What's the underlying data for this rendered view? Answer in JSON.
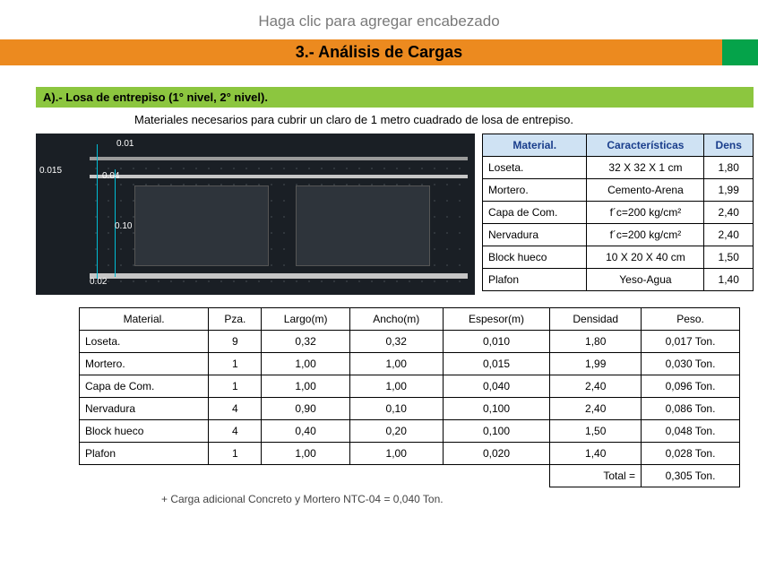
{
  "eyebrow": "Haga clic para agregar encabezado",
  "title": "3.- Análisis de Cargas",
  "section_a": "A).- Losa de entrepiso (1° nivel, 2° nivel).",
  "description": "Materiales necesarios para cubrir un claro de 1 metro cuadrado de losa de entrepiso.",
  "cad": {
    "d1": "0.01",
    "d2": "0.04",
    "d3": "0.015",
    "d4": "0.10",
    "d5": "0.02"
  },
  "side_table": {
    "headers": {
      "c1": "Material.",
      "c2": "Características",
      "c3": "Dens"
    },
    "rows": [
      {
        "mat": "Loseta.",
        "car": "32 X 32 X 1 cm",
        "den": "1,80"
      },
      {
        "mat": "Mortero.",
        "car": "Cemento-Arena",
        "den": "1,99"
      },
      {
        "mat": "Capa de Com.",
        "car": "f´c=200 kg/cm²",
        "den": "2,40"
      },
      {
        "mat": "Nervadura",
        "car": "f´c=200 kg/cm²",
        "den": "2,40"
      },
      {
        "mat": "Block hueco",
        "car": "10 X 20 X 40 cm",
        "den": "1,50"
      },
      {
        "mat": "Plafon",
        "car": "Yeso-Agua",
        "den": "1,40"
      }
    ]
  },
  "main_table": {
    "headers": {
      "c1": "Material.",
      "c2": "Pza.",
      "c3": "Largo(m)",
      "c4": "Ancho(m)",
      "c5": "Espesor(m)",
      "c6": "Densidad",
      "c7": "Peso."
    },
    "rows": [
      {
        "mat": "Loseta.",
        "pza": "9",
        "lar": "0,32",
        "anc": "0,32",
        "esp": "0,010",
        "den": "1,80",
        "pes": "0,017 Ton."
      },
      {
        "mat": "Mortero.",
        "pza": "1",
        "lar": "1,00",
        "anc": "1,00",
        "esp": "0,015",
        "den": "1,99",
        "pes": "0,030 Ton."
      },
      {
        "mat": "Capa de Com.",
        "pza": "1",
        "lar": "1,00",
        "anc": "1,00",
        "esp": "0,040",
        "den": "2,40",
        "pes": "0,096 Ton."
      },
      {
        "mat": "Nervadura",
        "pza": "4",
        "lar": "0,90",
        "anc": "0,10",
        "esp": "0,100",
        "den": "2,40",
        "pes": "0,086 Ton."
      },
      {
        "mat": "Block hueco",
        "pza": "4",
        "lar": "0,40",
        "anc": "0,20",
        "esp": "0,100",
        "den": "1,50",
        "pes": "0,048 Ton."
      },
      {
        "mat": "Plafon",
        "pza": "1",
        "lar": "1,00",
        "anc": "1,00",
        "esp": "0,020",
        "den": "1,40",
        "pes": "0,028 Ton."
      }
    ],
    "total_label": "Total =",
    "total_value": "0,305 Ton."
  },
  "footnote": "+ Carga adicional Concreto y Mortero NTC-04 =    0,040 Ton."
}
